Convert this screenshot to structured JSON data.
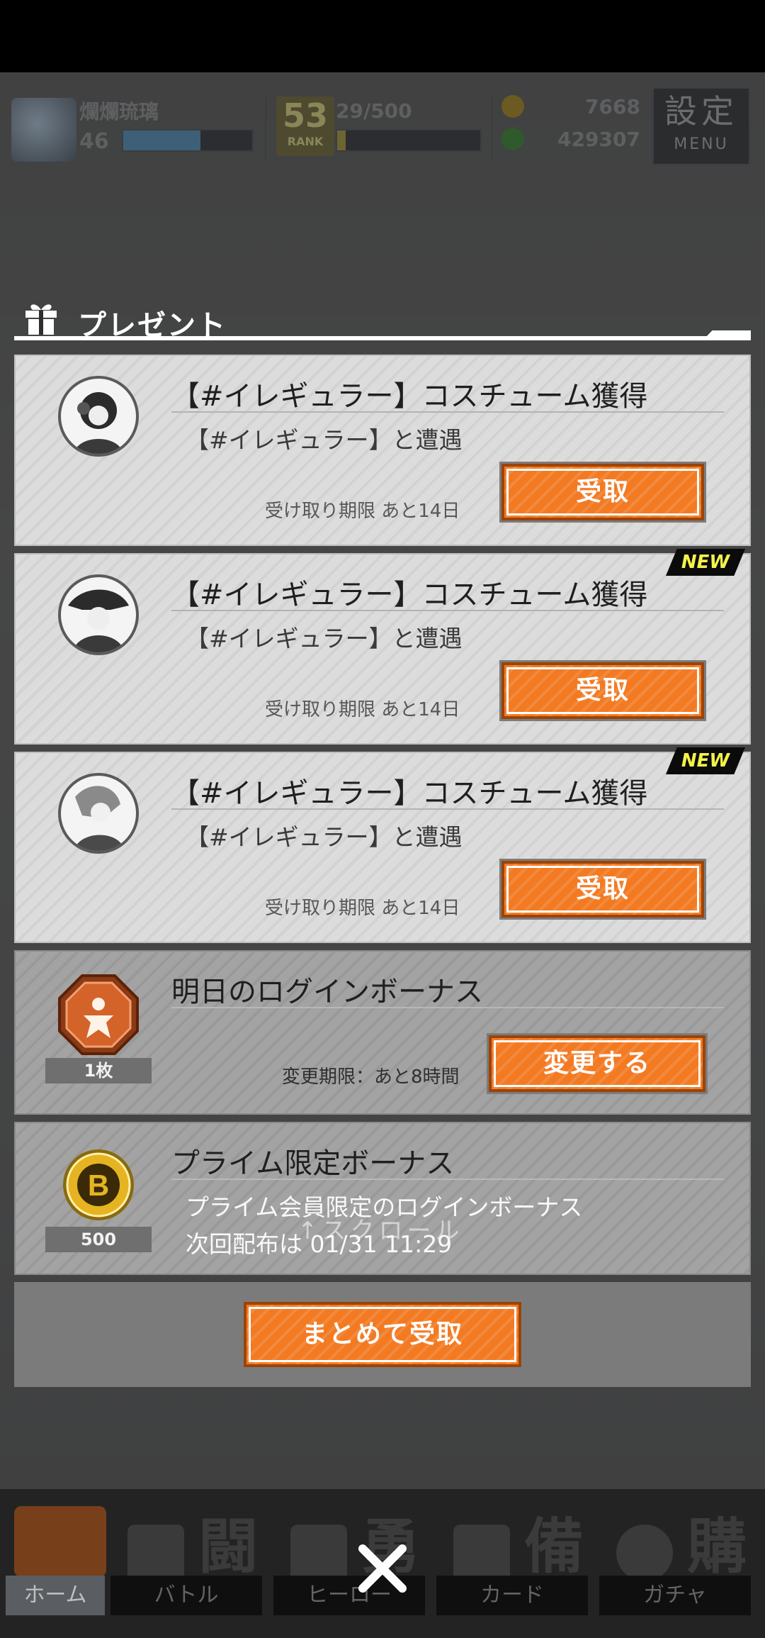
{
  "hud": {
    "player_name": "爛爛琉璃",
    "level": "46",
    "level_progress": 0.6,
    "rank": "53",
    "rank_label": "RANK",
    "exp": "29/500",
    "exp_progress": 0.06,
    "currency_primary": "7668",
    "currency_secondary": "429307",
    "menu_kanji": "設定",
    "menu_label": "MENU"
  },
  "present": {
    "title": "プレゼント",
    "items": [
      {
        "title": "【#イレギュラー】コスチューム獲得",
        "subtitle": "【#イレギュラー】と遭遇",
        "deadline": "受け取り期限 あと14日",
        "button": "受取",
        "badge": ""
      },
      {
        "title": "【#イレギュラー】コスチューム獲得",
        "subtitle": "【#イレギュラー】と遭遇",
        "deadline": "受け取り期限 あと14日",
        "button": "受取",
        "badge": "NEW"
      },
      {
        "title": "【#イレギュラー】コスチューム獲得",
        "subtitle": "【#イレギュラー】と遭遇",
        "deadline": "受け取り期限 あと14日",
        "button": "受取",
        "badge": "NEW"
      }
    ],
    "login_bonus": {
      "title": "明日のログインボーナス",
      "count": "1枚",
      "deadline": "変更期限：あと8時間",
      "button": "変更する"
    },
    "prime_bonus": {
      "title": "プライム限定ボーナス",
      "line1": "プライム会員限定のログインボーナス",
      "line2": "次回配布は 01/31 11:29",
      "count": "500"
    },
    "scroll_hint": "↑スクロール",
    "bulk_button": "まとめて受取"
  },
  "nav": {
    "items": [
      {
        "label": "ホーム",
        "kanji": ""
      },
      {
        "label": "バトル",
        "kanji": "闘"
      },
      {
        "label": "ヒーロー",
        "kanji": "勇"
      },
      {
        "label": "カード",
        "kanji": "備"
      },
      {
        "label": "ガチャ",
        "kanji": "購"
      }
    ]
  },
  "colors": {
    "accent_orange": "#f47a22",
    "new_badge_text": "#f2f24a"
  }
}
